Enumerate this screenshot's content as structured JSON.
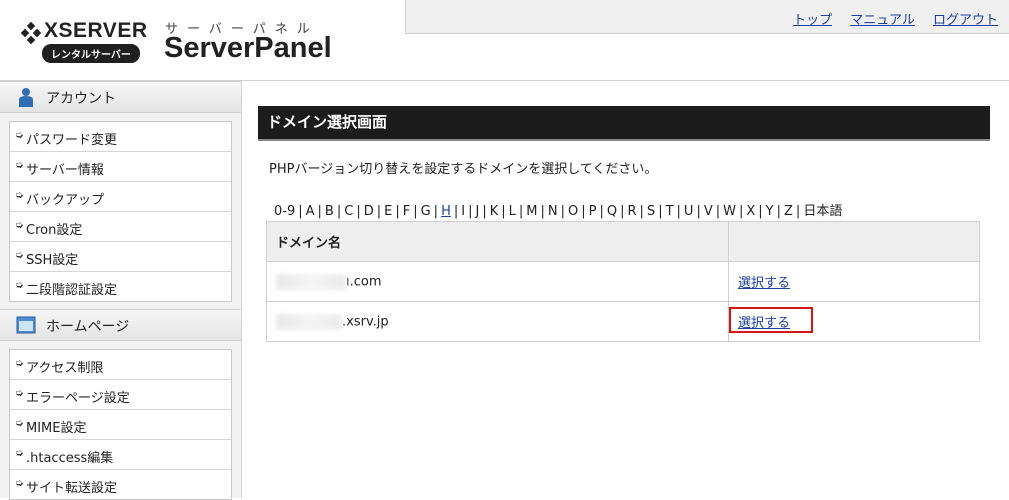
{
  "header": {
    "logo_text": "XSERVER",
    "logo_badge": "レンタルサーバー",
    "panel_subtitle": "サーバーパネル",
    "panel_title": "ServerPanel",
    "links": [
      {
        "label": "トップ"
      },
      {
        "label": "マニュアル"
      },
      {
        "label": "ログアウト"
      }
    ]
  },
  "sidebar": {
    "sections": [
      {
        "title": "アカウント",
        "icon": "user-icon",
        "items": [
          "パスワード変更",
          "サーバー情報",
          "バックアップ",
          "Cron設定",
          "SSH設定",
          "二段階認証設定"
        ]
      },
      {
        "title": "ホームページ",
        "icon": "webpage-icon",
        "items": [
          "アクセス制限",
          "エラーページ設定",
          "MIME設定",
          ".htaccess編集",
          "サイト転送設定"
        ]
      }
    ]
  },
  "main": {
    "heading": "ドメイン選択画面",
    "instruction": "PHPバージョン切り替えを設定するドメインを選択してください。",
    "alpha_nav": [
      "0-9",
      "A",
      "B",
      "C",
      "D",
      "E",
      "F",
      "G",
      "H",
      "I",
      "J",
      "K",
      "L",
      "M",
      "N",
      "O",
      "P",
      "Q",
      "R",
      "S",
      "T",
      "U",
      "V",
      "W",
      "X",
      "Y",
      "Z",
      "日本語"
    ],
    "alpha_active": "H",
    "table": {
      "headers": [
        "ドメイン名",
        ""
      ],
      "rows": [
        {
          "domain_suffix": "ı.com",
          "action": "選択する"
        },
        {
          "domain_suffix": ".xsrv.jp",
          "action": "選択する"
        }
      ]
    }
  },
  "colors": {
    "link": "#1a3fa6",
    "heading_bg": "#1c1c1c",
    "highlight": "#d11616"
  }
}
